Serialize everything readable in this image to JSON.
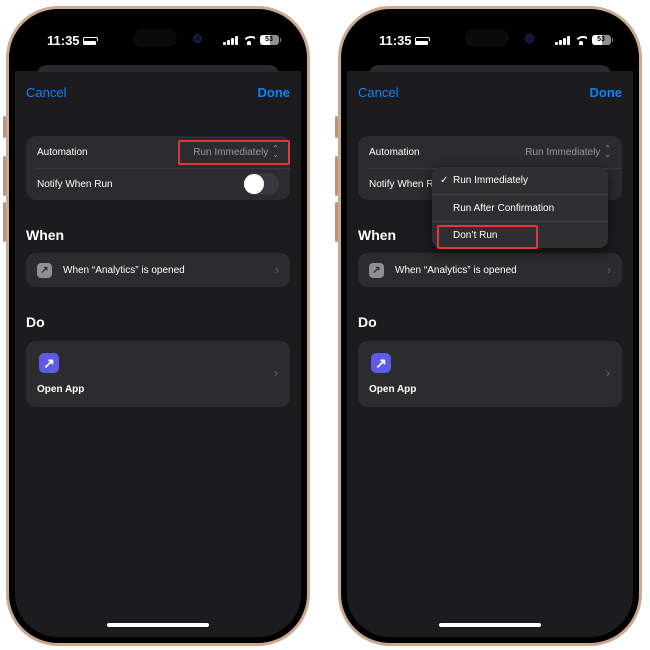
{
  "screens": [
    {
      "status": {
        "time": "11:35",
        "battery": "53"
      },
      "nav": {
        "cancel": "Cancel",
        "done": "Done"
      },
      "settings": {
        "automation_label": "Automation",
        "automation_value": "Run Immediately",
        "notify_label": "Notify When Run",
        "notify_on": false
      },
      "when": {
        "title": "When",
        "trigger": "When “Analytics” is opened",
        "icon": "arrow-up-right-icon"
      },
      "do": {
        "title": "Do",
        "action": "Open App",
        "icon": "arrow-up-right-icon"
      },
      "highlight": "automation-picker"
    },
    {
      "status": {
        "time": "11:35",
        "battery": "53"
      },
      "nav": {
        "cancel": "Cancel",
        "done": "Done"
      },
      "settings": {
        "automation_label": "Automation",
        "automation_value": "Run Immediately",
        "notify_label": "Notify When Run"
      },
      "menu": {
        "items": [
          {
            "label": "Run Immediately",
            "checked": true
          },
          {
            "label": "Run After Confirmation",
            "checked": false
          },
          {
            "label": "Don’t Run",
            "checked": false
          }
        ],
        "check_glyph": "✓"
      },
      "when": {
        "title": "When",
        "trigger": "When “Analytics” is opened",
        "icon": "arrow-up-right-icon"
      },
      "do": {
        "title": "Do",
        "action": "Open App",
        "icon": "arrow-up-right-icon"
      },
      "highlight": "menu-item-dont-run"
    }
  ],
  "glyphs": {
    "chevron": "›",
    "arrow": "↗",
    "updown": "⌃⌄"
  },
  "colors": {
    "accent": "#0a84ff",
    "highlight": "#e5333f",
    "action_icon": "#5e5ce6"
  }
}
